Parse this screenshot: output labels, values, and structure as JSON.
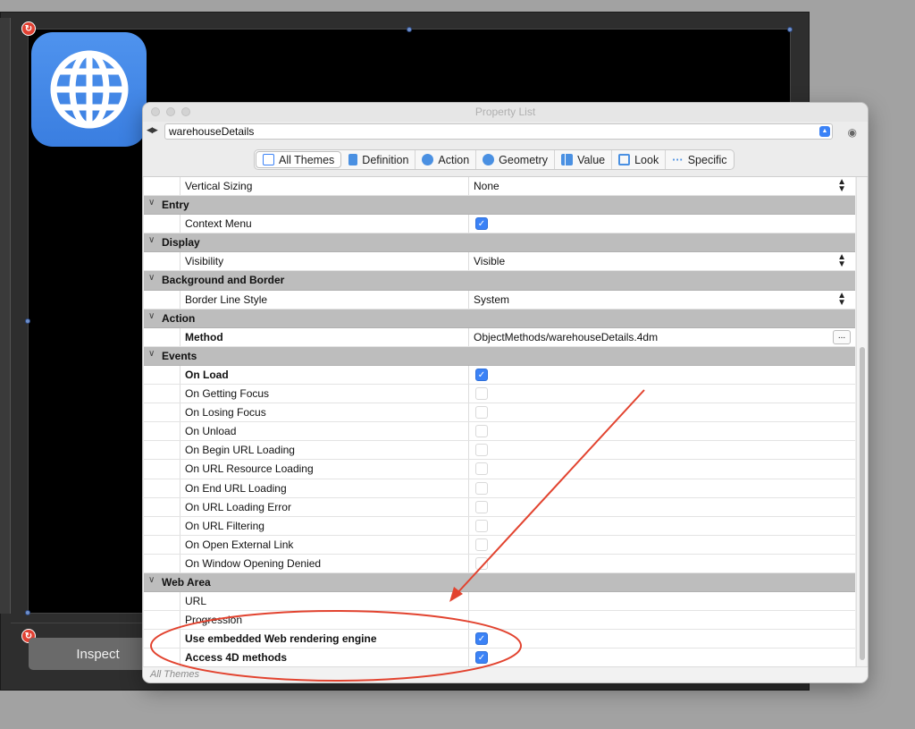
{
  "editor": {
    "inspect_label": "Inspect",
    "web_area_icon": "globe-icon",
    "badge_icon": "link-badge-icon"
  },
  "property_list": {
    "title": "Property List",
    "object_name": "warehouseDetails",
    "tabs": [
      {
        "label": "All Themes",
        "icon": "list-icon"
      },
      {
        "label": "Definition",
        "icon": "document-icon"
      },
      {
        "label": "Action",
        "icon": "gear-icon"
      },
      {
        "label": "Geometry",
        "icon": "geometry-icon"
      },
      {
        "label": "Value",
        "icon": "chart-icon"
      },
      {
        "label": "Look",
        "icon": "monitor-icon"
      },
      {
        "label": "Specific",
        "icon": "dots-icon"
      }
    ],
    "rows": {
      "vertical_sizing": {
        "name": "Vertical Sizing",
        "value": "None"
      },
      "entry": "Entry",
      "context_menu": "Context Menu",
      "display": "Display",
      "visibility": {
        "name": "Visibility",
        "value": "Visible"
      },
      "background_border": "Background and Border",
      "border_line_style": {
        "name": "Border Line Style",
        "value": "System"
      },
      "action": "Action",
      "method": {
        "name": "Method",
        "value": "ObjectMethods/warehouseDetails.4dm",
        "button": "..."
      },
      "events": "Events",
      "on_load": "On Load",
      "on_getting_focus": "On Getting Focus",
      "on_losing_focus": "On Losing Focus",
      "on_unload": "On Unload",
      "on_begin_url_loading": "On Begin URL Loading",
      "on_url_resource_loading": "On URL Resource Loading",
      "on_end_url_loading": "On End URL Loading",
      "on_url_loading_error": "On URL Loading Error",
      "on_url_filtering": "On URL Filtering",
      "on_open_external_link": "On Open External Link",
      "on_window_opening_denied": "On Window Opening Denied",
      "web_area": "Web Area",
      "url": "URL",
      "progression": "Progression",
      "use_embedded_engine": "Use embedded Web rendering engine",
      "access_4d_methods": "Access 4D methods"
    },
    "checks": {
      "context_menu": true,
      "on_load": true,
      "use_embedded_engine": true,
      "access_4d_methods": true
    },
    "footer": "All Themes"
  },
  "colors": {
    "accent": "#3b82f6",
    "annotation": "#e2432f"
  }
}
